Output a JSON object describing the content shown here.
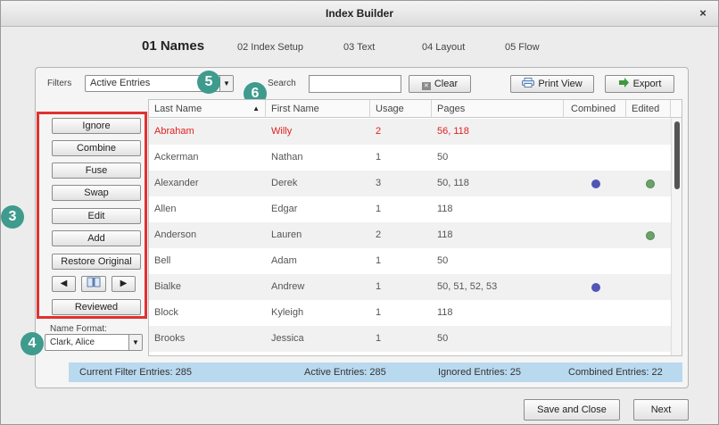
{
  "window": {
    "title": "Index Builder",
    "close_glyph": "×"
  },
  "steps": [
    {
      "label": "01 Names",
      "active": true
    },
    {
      "label": "02 Index Setup"
    },
    {
      "label": "03 Text"
    },
    {
      "label": "04 Layout"
    },
    {
      "label": "05 Flow"
    }
  ],
  "filters": {
    "label": "Filters",
    "selected": "Active Entries"
  },
  "search": {
    "label": "Search",
    "value": "",
    "clear_label": "Clear"
  },
  "toolbar": {
    "print_view_label": "Print View",
    "export_label": "Export"
  },
  "sidebar": {
    "buttons": [
      "Ignore",
      "Combine",
      "Fuse",
      "Swap",
      "Edit",
      "Add",
      "Restore Original"
    ],
    "prev_glyph": "◀",
    "next_glyph": "▶",
    "reviewed_label": "Reviewed",
    "name_format_label": "Name Format:",
    "name_format_value": "Clark, Alice"
  },
  "callouts": {
    "three": "3",
    "four": "4",
    "five": "5",
    "six": "6"
  },
  "table": {
    "columns": [
      "Last Name",
      "First Name",
      "Usage",
      "Pages",
      "Combined",
      "Edited"
    ],
    "rows": [
      {
        "last": "Abraham",
        "first": "Willy",
        "usage": "2",
        "pages": "56, 118",
        "combined": false,
        "edited": false,
        "flagged": true
      },
      {
        "last": "Ackerman",
        "first": "Nathan",
        "usage": "1",
        "pages": "50",
        "combined": false,
        "edited": false
      },
      {
        "last": "Alexander",
        "first": "Derek",
        "usage": "3",
        "pages": "50, 118",
        "combined": true,
        "edited": true
      },
      {
        "last": "Allen",
        "first": "Edgar",
        "usage": "1",
        "pages": "118",
        "combined": false,
        "edited": false
      },
      {
        "last": "Anderson",
        "first": "Lauren",
        "usage": "2",
        "pages": "118",
        "combined": false,
        "edited": true
      },
      {
        "last": "Bell",
        "first": "Adam",
        "usage": "1",
        "pages": "50",
        "combined": false,
        "edited": false,
        "marker": true
      },
      {
        "last": "Bialke",
        "first": "Andrew",
        "usage": "1",
        "pages": "50, 51, 52, 53",
        "combined": true,
        "edited": false
      },
      {
        "last": "Block",
        "first": "Kyleigh",
        "usage": "1",
        "pages": "118",
        "combined": false,
        "edited": false
      },
      {
        "last": "Brooks",
        "first": "Jessica",
        "usage": "1",
        "pages": "50",
        "combined": false,
        "edited": false
      }
    ]
  },
  "status": {
    "current_filter": "Current Filter Entries: 285",
    "active": "Active Entries: 285",
    "ignored": "Ignored Entries: 25",
    "combined": "Combined Entries: 22"
  },
  "footer": {
    "save_close_label": "Save and Close",
    "next_label": "Next"
  },
  "colors": {
    "accent_red": "#e03131",
    "callout_teal": "#3e9b8e",
    "combined_dot": "#5056b6",
    "edited_dot": "#6aa36a",
    "status_bar": "#b9d9ef"
  }
}
